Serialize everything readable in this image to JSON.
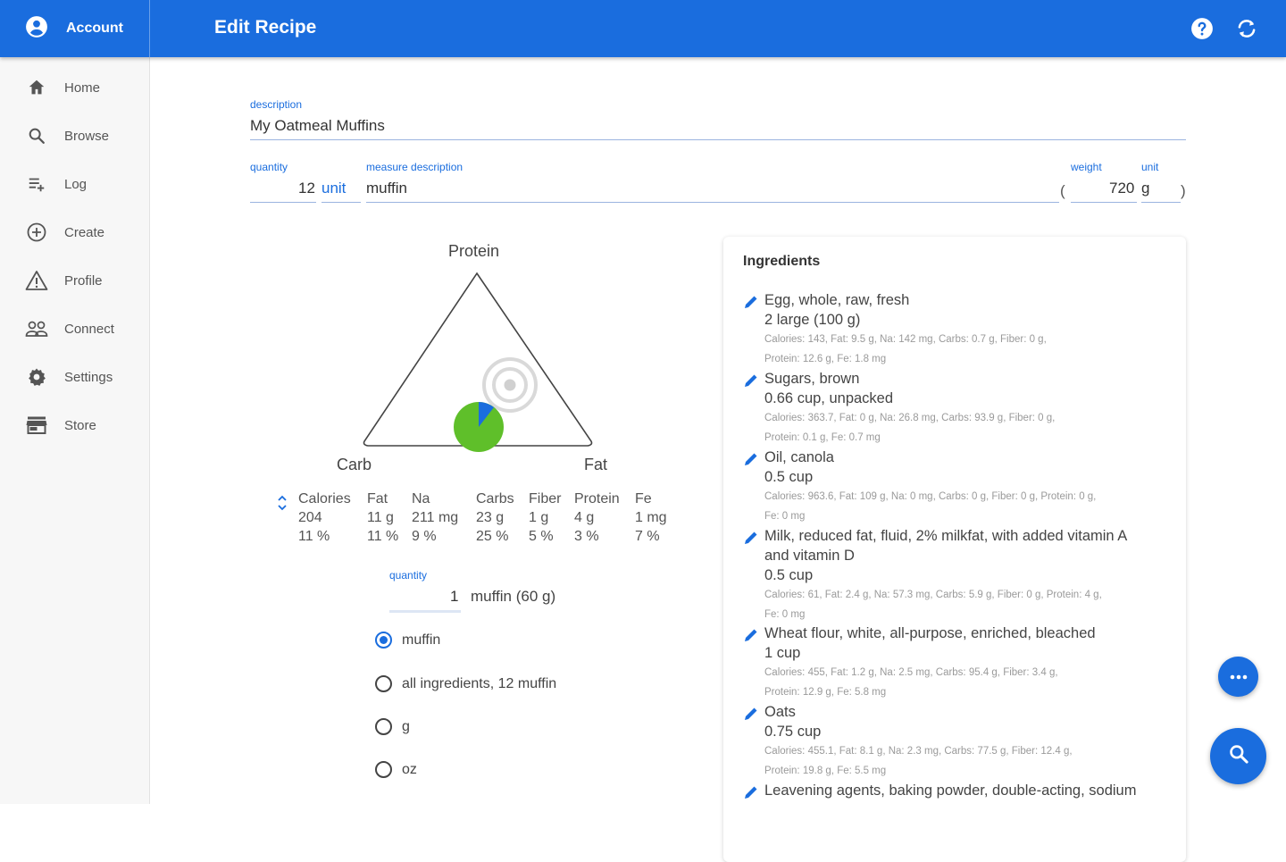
{
  "header": {
    "account_label": "Account",
    "title": "Edit Recipe",
    "help_icon": "help-circle-icon",
    "sync_icon": "sync-icon"
  },
  "sidebar": {
    "items": [
      {
        "label": "Home",
        "icon": "home-icon"
      },
      {
        "label": "Browse",
        "icon": "search-icon"
      },
      {
        "label": "Log",
        "icon": "playlist-add-icon"
      },
      {
        "label": "Create",
        "icon": "add-circle-icon"
      },
      {
        "label": "Profile",
        "icon": "triangle-alert-icon"
      },
      {
        "label": "Connect",
        "icon": "people-icon"
      },
      {
        "label": "Settings",
        "icon": "gear-icon"
      },
      {
        "label": "Store",
        "icon": "store-icon"
      }
    ]
  },
  "form": {
    "description_label": "description",
    "description_value": "My Oatmeal Muffins",
    "quantity_label": "quantity",
    "quantity_value": "12",
    "unit_value": "unit",
    "measure_label": "measure description",
    "measure_value": "muffin",
    "weight_label": "weight",
    "weight_value": "720",
    "weight_unit_label": "unit",
    "weight_unit_value": "g",
    "paren_open": "(",
    "paren_close": ")"
  },
  "ratio_chart": {
    "top_label": "Protein",
    "left_label": "Carb",
    "right_label": "Fat"
  },
  "nutrition": {
    "headers": [
      "Calories",
      "Fat",
      "Na",
      "Carbs",
      "Fiber",
      "Protein",
      "Fe"
    ],
    "amounts": [
      "204",
      "11 g",
      "211 mg",
      "23 g",
      "1 g",
      "4 g",
      "1 mg"
    ],
    "percents": [
      "11 %",
      "11 %",
      "9 %",
      "25 %",
      "5 %",
      "3 %",
      "7 %"
    ]
  },
  "serving": {
    "quantity_label": "quantity",
    "quantity_value": "1",
    "unit_text": "muffin (60 g)",
    "options": [
      {
        "label": "muffin",
        "selected": true
      },
      {
        "label": "all ingredients, 12 muffin",
        "selected": false
      },
      {
        "label": "g",
        "selected": false
      },
      {
        "label": "oz",
        "selected": false
      }
    ]
  },
  "ingredients": {
    "title": "Ingredients",
    "items": [
      {
        "name": "Egg, whole, raw, fresh",
        "qty": "2 large (100 g)",
        "detail1": "Calories: 143, Fat: 9.5 g, Na: 142 mg, Carbs: 0.7 g, Fiber: 0 g,",
        "detail2": "Protein: 12.6 g, Fe: 1.8 mg"
      },
      {
        "name": "Sugars, brown",
        "qty": "0.66 cup, unpacked",
        "detail1": "Calories: 363.7, Fat: 0 g, Na: 26.8 mg, Carbs: 93.9 g, Fiber: 0 g,",
        "detail2": "Protein: 0.1 g, Fe: 0.7 mg"
      },
      {
        "name": "Oil, canola",
        "qty": "0.5 cup",
        "detail1": "Calories: 963.6, Fat: 109 g, Na: 0 mg, Carbs: 0 g, Fiber: 0 g, Protein: 0 g,",
        "detail2": "Fe: 0 mg"
      },
      {
        "name": "Milk, reduced fat, fluid, 2% milkfat, with added vitamin A",
        "name2": "and vitamin D",
        "qty": "0.5 cup",
        "detail1": "Calories: 61, Fat: 2.4 g, Na: 57.3 mg, Carbs: 5.9 g, Fiber: 0 g, Protein: 4 g,",
        "detail2": "Fe: 0 mg"
      },
      {
        "name": "Wheat flour, white, all-purpose, enriched, bleached",
        "qty": "1 cup",
        "detail1": "Calories: 455, Fat: 1.2 g, Na: 2.5 mg, Carbs: 95.4 g, Fiber: 3.4 g,",
        "detail2": "Protein: 12.9 g, Fe: 5.8 mg"
      },
      {
        "name": "Oats",
        "qty": "0.75 cup",
        "detail1": "Calories: 455.1, Fat: 8.1 g, Na: 2.3 mg, Carbs: 77.5 g, Fiber: 12.4 g,",
        "detail2": "Protein: 19.8 g, Fe: 5.5 mg"
      },
      {
        "name": "Leavening agents, baking powder, double-acting, sodium",
        "qty": "",
        "detail1": "",
        "detail2": ""
      }
    ]
  },
  "fabs": {
    "more_icon": "more-horiz-icon",
    "search_icon": "search-icon"
  },
  "colors": {
    "primary": "#1a6dde",
    "pie_green": "#5fbf2a",
    "pie_blue": "#1a6dde"
  }
}
